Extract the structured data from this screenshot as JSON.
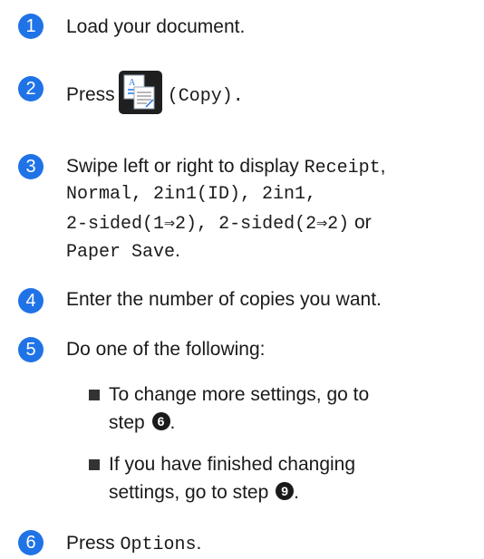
{
  "steps": [
    {
      "number": "1",
      "text": "Load your document."
    },
    {
      "number": "2",
      "pre": "Press",
      "icon": "copy-icon",
      "post": "(Copy)."
    },
    {
      "number": "3",
      "l1a": "Swipe left or right to display ",
      "l1b": "Receipt",
      "l1c": ",",
      "l2": "Normal, 2in1(ID), 2in1,",
      "l3a": "2-sided(1⇒2), 2-sided(2⇒2)",
      "l3b": " or",
      "l4a": "Paper Save",
      "l4b": "."
    },
    {
      "number": "4",
      "text": "Enter the number of copies you want."
    },
    {
      "number": "5",
      "text": "Do one of the following:",
      "bullets": [
        {
          "l1": "To change more settings, go to",
          "l2": "step",
          "ref": "6",
          "end": "."
        },
        {
          "l1": "If you have finished changing",
          "l2": "settings, go to step",
          "ref": "9",
          "end": "."
        }
      ]
    },
    {
      "number": "6",
      "pre": "Press ",
      "mono": "Options",
      "post": "."
    }
  ],
  "colors": {
    "accent": "#1f73e6",
    "icon_bg": "#1f1f1f"
  }
}
